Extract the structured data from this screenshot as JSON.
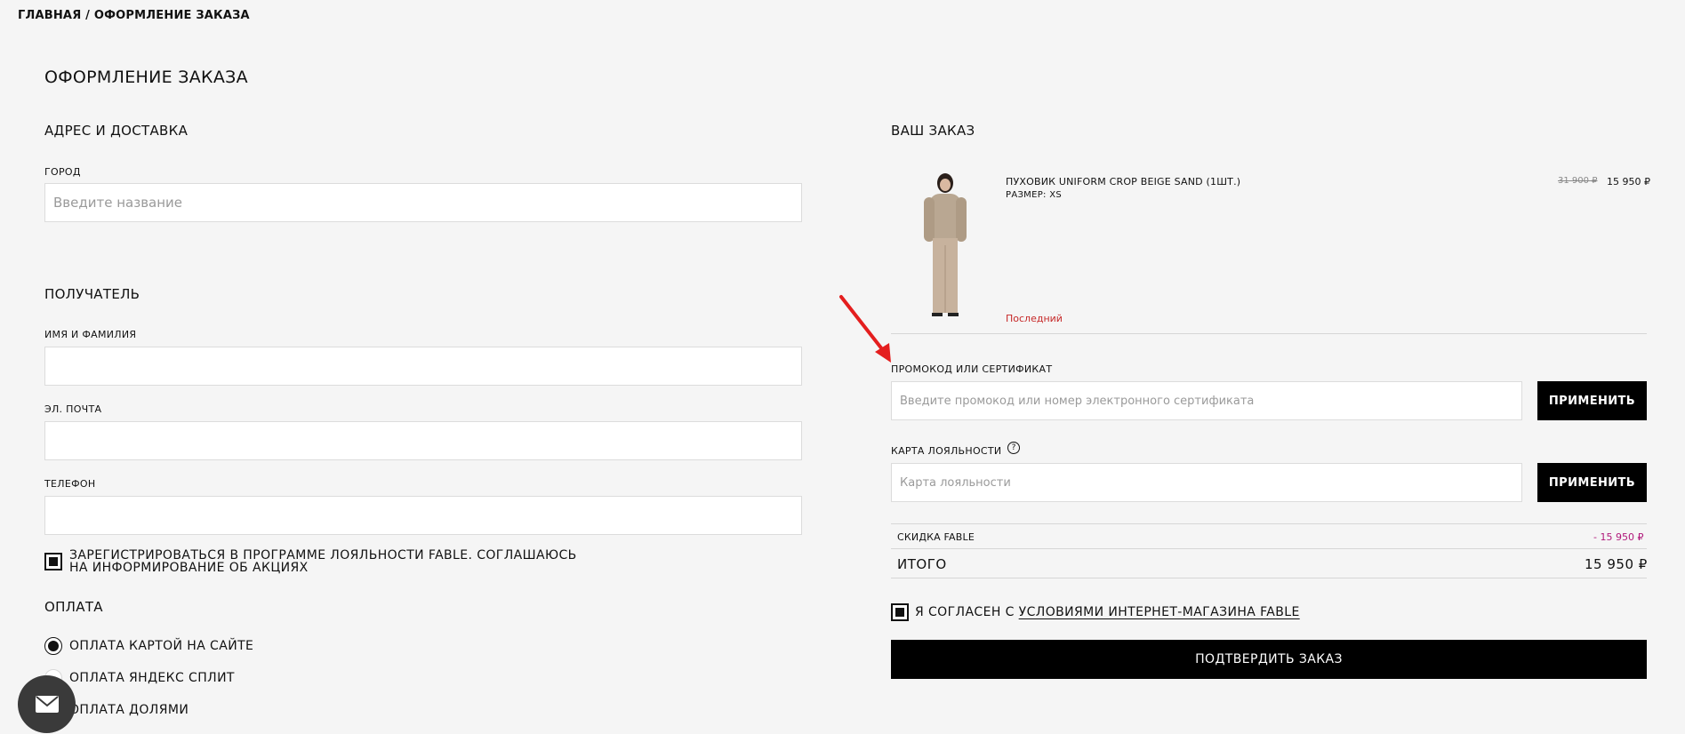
{
  "breadcrumb": {
    "home": "ГЛАВНАЯ",
    "separator": "/",
    "current": "ОФОРМЛЕНИЕ ЗАКАЗА"
  },
  "page_title": "ОФОРМЛЕНИЕ ЗАКАЗА",
  "address": {
    "title": "АДРЕС И ДОСТАВКА",
    "city_label": "ГОРОД",
    "city_placeholder": "Введите название"
  },
  "recipient": {
    "title": "ПОЛУЧАТЕЛЬ",
    "name_label": "ИМЯ И ФАМИЛИЯ",
    "email_label": "ЭЛ. ПОЧТА",
    "phone_label": "ТЕЛЕФОН",
    "loyalty_line1": "ЗАРЕГИСТРИРОВАТЬСЯ В ПРОГРАММЕ ЛОЯЛЬНОСТИ FABLE. СОГЛАШАЮСЬ",
    "loyalty_line2": "НА ИНФОРМИРОВАНИЕ ОБ АКЦИЯХ"
  },
  "payment": {
    "title": "ОПЛАТА",
    "options": [
      "ОПЛАТА КАРТОЙ НА САЙТЕ",
      "ОПЛАТА ЯНДЕКС СПЛИТ",
      "ОПЛАТА ДОЛЯМИ"
    ]
  },
  "order": {
    "title": "ВАШ ЗАКАЗ",
    "product": {
      "name": "ПУХОВИК UNIFORM CROP BEIGE SAND (1ШТ.)",
      "size": "РАЗМЕР: XS",
      "stock": "Последний",
      "old_price": "31 900 ₽",
      "price": "15 950 ₽"
    },
    "promo_label": "ПРОМОКОД ИЛИ СЕРТИФИКАТ",
    "promo_placeholder": "Введите промокод или номер электронного сертификата",
    "apply_label": "ПРИМЕНИТЬ",
    "loyalty_label": "КАРТА ЛОЯЛЬНОСТИ",
    "loyalty_placeholder": "Карта лояльности",
    "help_glyph": "?",
    "discount_label": "СКИДКА FABLE",
    "discount_value": "- 15 950 ₽",
    "total_label": "ИТОГО",
    "total_value": "15 950 ₽",
    "terms_prefix": "Я СОГЛАСЕН С",
    "terms_link": "УСЛОВИЯМИ ИНТЕРНЕТ-МАГАЗИНА FABLE",
    "confirm_label": "ПОДТВЕРДИТЬ ЗАКАЗ"
  },
  "colors": {
    "background": "#f5f5f5",
    "button": "#000000",
    "stock_warning": "#c62828",
    "discount": "#b0187a",
    "annotation_arrow": "#e41e1e"
  },
  "icons": [
    "mail-icon",
    "help-icon",
    "annotation-arrow"
  ]
}
